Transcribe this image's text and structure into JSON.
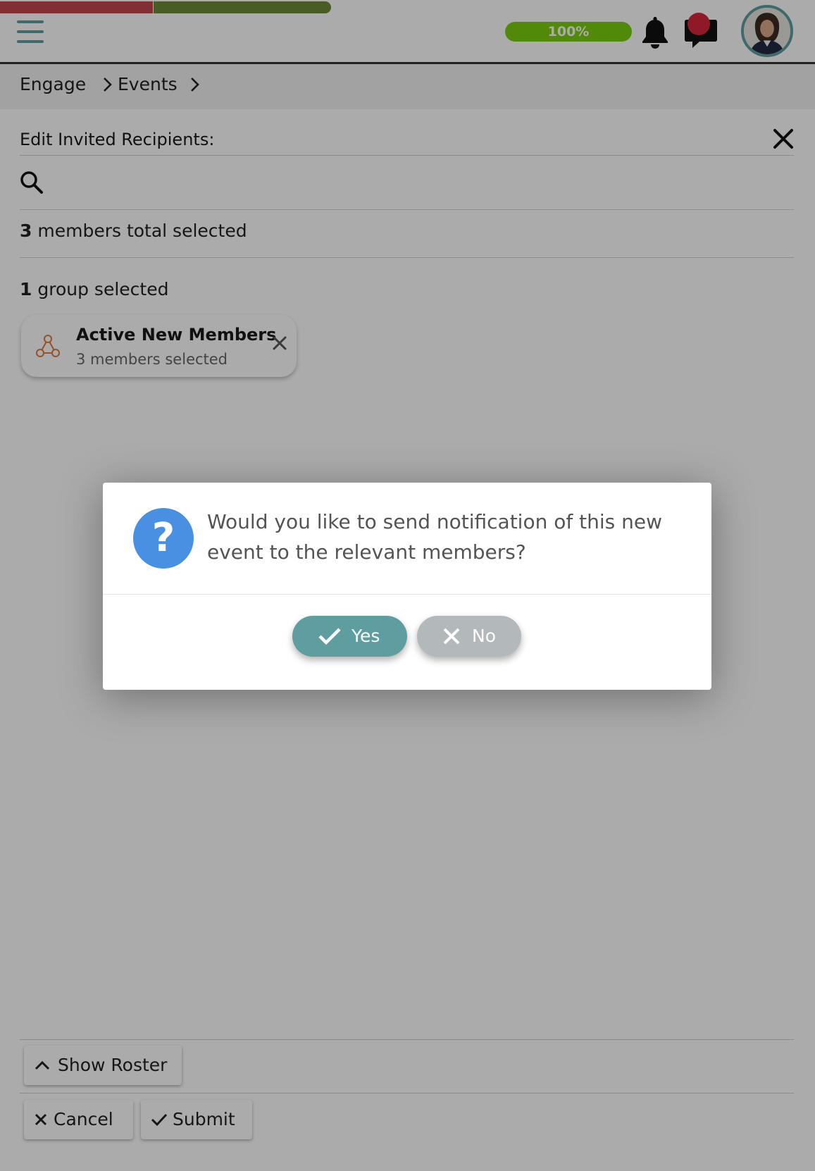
{
  "header": {
    "progress_label": "100%",
    "progress_value": 100,
    "icons": {
      "menu": "hamburger-icon",
      "notifications": "bell-icon",
      "messages": "chat-icon",
      "avatar": "avatar"
    }
  },
  "breadcrumb": {
    "items": [
      {
        "label": "Engage"
      },
      {
        "label": "Events"
      }
    ]
  },
  "panel": {
    "title": "Edit Invited Recipients:",
    "search": {
      "value": "",
      "placeholder": ""
    },
    "members_count": "3",
    "members_text": "members total selected",
    "groups_count": "1",
    "groups_text": "group selected",
    "group_chip": {
      "name": "Active New Members",
      "subtitle": "3 members selected"
    }
  },
  "footer": {
    "show_roster_label": "Show Roster",
    "cancel_label": "Cancel",
    "submit_label": "Submit"
  },
  "dialog": {
    "message": "Would you like to send notification of this new event to the relevant members?",
    "icon_glyph": "?",
    "yes_label": "Yes",
    "no_label": "No"
  },
  "colors": {
    "accent_teal": "#5f9ea0",
    "progress_green": "#7acc0e",
    "question_blue": "#4a90e2",
    "group_icon_orange": "#e07b3a",
    "notification_red": "#d7263d",
    "strip_red": "#c24550",
    "strip_olive": "#6e8a3a"
  }
}
